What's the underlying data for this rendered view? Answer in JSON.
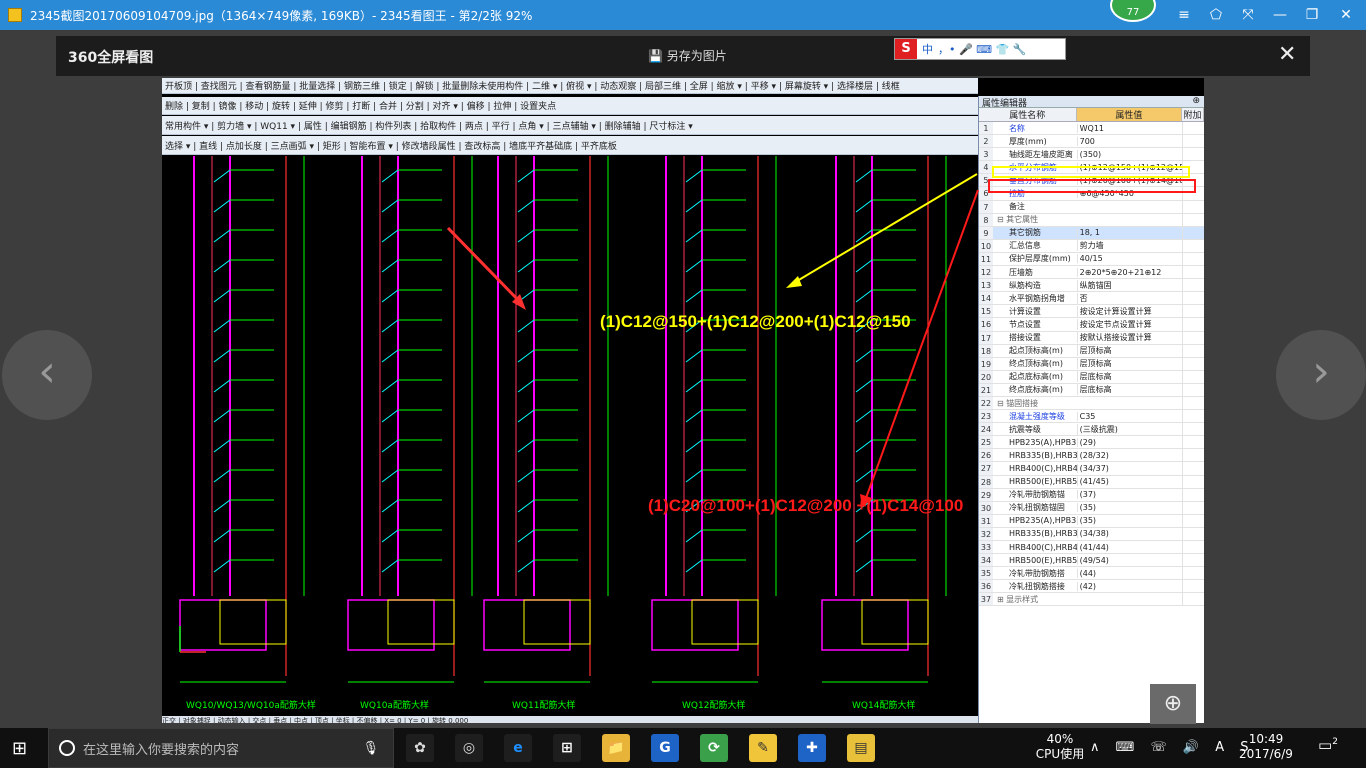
{
  "window": {
    "title": "2345截图20170609104709.jpg（1364×749像素, 169KB）- 2345看图王 - 第2/2张 92%",
    "avatar_badge": "77",
    "buttons": [
      "≡",
      "⬠",
      "⤧",
      "—",
      "❐",
      "✕"
    ]
  },
  "viewer": {
    "logo": "360全屏看图",
    "save_as": "另存为图片",
    "close": "✕",
    "prev": "‹",
    "next": "›",
    "zoom": "⊕"
  },
  "ime": {
    "logo": "S",
    "lang": "中",
    "extras": "，• 🎤 ⌨ 👕 🔧"
  },
  "cad_toolbars": [
    "开板顶 | 查找图元 | 查看钢筋量 | 批量选择 | 钢筋三维 | 锁定 | 解锁 | 批量删除未使用构件 | 二维 ▾ | 俯视 ▾ | 动态观察 | 局部三维 | 全屏 | 缩放 ▾ | 平移 ▾ | 屏幕旋转 ▾ | 选择楼层 | 线框",
    "删除 | 复制 | 镜像 | 移动 | 旋转 | 延伸 | 修剪 | 打断 | 合并 | 分割 | 对齐 ▾ | 偏移 | 拉伸 | 设置夹点",
    "常用构件 ▾ | 剪力墙 ▾ | WQ11 ▾ | 属性 | 编辑钢筋 | 构件列表 | 拾取构件 | 两点 | 平行 | 点角 ▾ | 三点辅轴 ▾ | 删除辅轴 | 尺寸标注 ▾",
    "选择 ▾ | 直线 | 点加长度 | 三点画弧 ▾ | 矩形 | 智能布置 ▾ | 修改墙段属性 | 查改标高 | 墙底平齐基础底 | 平齐底板"
  ],
  "drawing_labels": [
    "WQ10/WQ13/WQ10a配筋大样",
    "WQ10a配筋大样",
    "WQ11配筋大样",
    "WQ12配筋大样",
    "WQ14配筋大样"
  ],
  "status_bar": "正交 | 对象捕捉 | 动态输入 | 交点 | 垂点 | 中点 | 顶点 | 坐标 | 不偏移 | X= 0 | Y= 0 | 旋转 0.000",
  "property_panel": {
    "title": "属性编辑器",
    "pin": "⊕",
    "headers": [
      "属性名称",
      "属性值",
      "附加"
    ],
    "rows": [
      {
        "n": "1",
        "k": "名称",
        "v": "WQ11",
        "blue": true
      },
      {
        "n": "2",
        "k": "厚度(mm)",
        "v": "700"
      },
      {
        "n": "3",
        "k": "轴线距左墙皮距离",
        "v": "(350)"
      },
      {
        "n": "4",
        "k": "水平分布钢筋",
        "v": "(1)⊕12@150+(1)⊕12@150",
        "blue": true
      },
      {
        "n": "5",
        "k": "垂直分布钢筋",
        "v": "(1)⊕20@100+(1)⊕14@100",
        "blue": true
      },
      {
        "n": "6",
        "k": "拉筋",
        "v": "⊕6@450*450",
        "blue": true
      },
      {
        "n": "7",
        "k": "备注",
        "v": ""
      },
      {
        "n": "8",
        "k": "⊟ 其它属性",
        "v": "",
        "group": true
      },
      {
        "n": "9",
        "k": "其它钢筋",
        "v": "18, 1",
        "hl": true
      },
      {
        "n": "10",
        "k": "汇总信息",
        "v": "剪力墙"
      },
      {
        "n": "11",
        "k": "保护层厚度(mm)",
        "v": "40/15"
      },
      {
        "n": "12",
        "k": "压墙筋",
        "v": "2⊕20*5⊕20+21⊕12"
      },
      {
        "n": "13",
        "k": "纵筋构造",
        "v": "纵筋锚固"
      },
      {
        "n": "14",
        "k": "水平钢筋拐角增",
        "v": "否"
      },
      {
        "n": "15",
        "k": "计算设置",
        "v": "按设定计算设置计算"
      },
      {
        "n": "16",
        "k": "节点设置",
        "v": "按设定节点设置计算"
      },
      {
        "n": "17",
        "k": "搭接设置",
        "v": "按默认搭接设置计算"
      },
      {
        "n": "18",
        "k": "起点顶标高(m)",
        "v": "层顶标高"
      },
      {
        "n": "19",
        "k": "终点顶标高(m)",
        "v": "层顶标高"
      },
      {
        "n": "20",
        "k": "起点底标高(m)",
        "v": "层底标高"
      },
      {
        "n": "21",
        "k": "终点底标高(m)",
        "v": "层底标高"
      },
      {
        "n": "22",
        "k": "⊟ 锚固搭接",
        "v": "",
        "group": true
      },
      {
        "n": "23",
        "k": "混凝土强度等级",
        "v": "C35",
        "blue": true
      },
      {
        "n": "24",
        "k": "抗震等级",
        "v": "(三级抗震)"
      },
      {
        "n": "25",
        "k": "HPB235(A),HPB3",
        "v": "(29)"
      },
      {
        "n": "26",
        "k": "HRB335(B),HRB3",
        "v": "(28/32)"
      },
      {
        "n": "27",
        "k": "HRB400(C),HRB4",
        "v": "(34/37)"
      },
      {
        "n": "28",
        "k": "HRB500(E),HRB5",
        "v": "(41/45)"
      },
      {
        "n": "29",
        "k": "冷轧带肋钢筋锚",
        "v": "(37)"
      },
      {
        "n": "30",
        "k": "冷轧扭钢筋锚固",
        "v": "(35)"
      },
      {
        "n": "31",
        "k": "HPB235(A),HPB3",
        "v": "(35)"
      },
      {
        "n": "32",
        "k": "HRB335(B),HRB3",
        "v": "(34/38)"
      },
      {
        "n": "33",
        "k": "HRB400(C),HRB4",
        "v": "(41/44)"
      },
      {
        "n": "34",
        "k": "HRB500(E),HRB5",
        "v": "(49/54)"
      },
      {
        "n": "35",
        "k": "冷轧带肋钢筋搭",
        "v": "(44)"
      },
      {
        "n": "36",
        "k": "冷轧扭钢筋搭接",
        "v": "(42)"
      },
      {
        "n": "37",
        "k": "⊞ 显示样式",
        "v": "",
        "group": true
      }
    ]
  },
  "annotations": {
    "yellow": "(1)C12@150+(1)C12@200+(1)C12@150",
    "red": "(1)C20@100+(1)C12@200 +(1)C14@100",
    "yellow_color": "#ffff00",
    "red_color": "#ff1a1a"
  },
  "taskbar": {
    "start": "⊞",
    "search_placeholder": "在这里输入你要搜索的内容",
    "mic": "🎙",
    "cpu_percent": "40%",
    "cpu_label": "CPU使用",
    "tray": "∧ ⌨ ☏ 🔊 A S",
    "time": "10:49",
    "date": "2017/6/9",
    "notifications": "2",
    "apps": [
      "✿",
      "◎",
      "e",
      "⊞",
      "📁",
      "G",
      "⟳",
      "✎",
      "✚",
      "▤"
    ]
  }
}
